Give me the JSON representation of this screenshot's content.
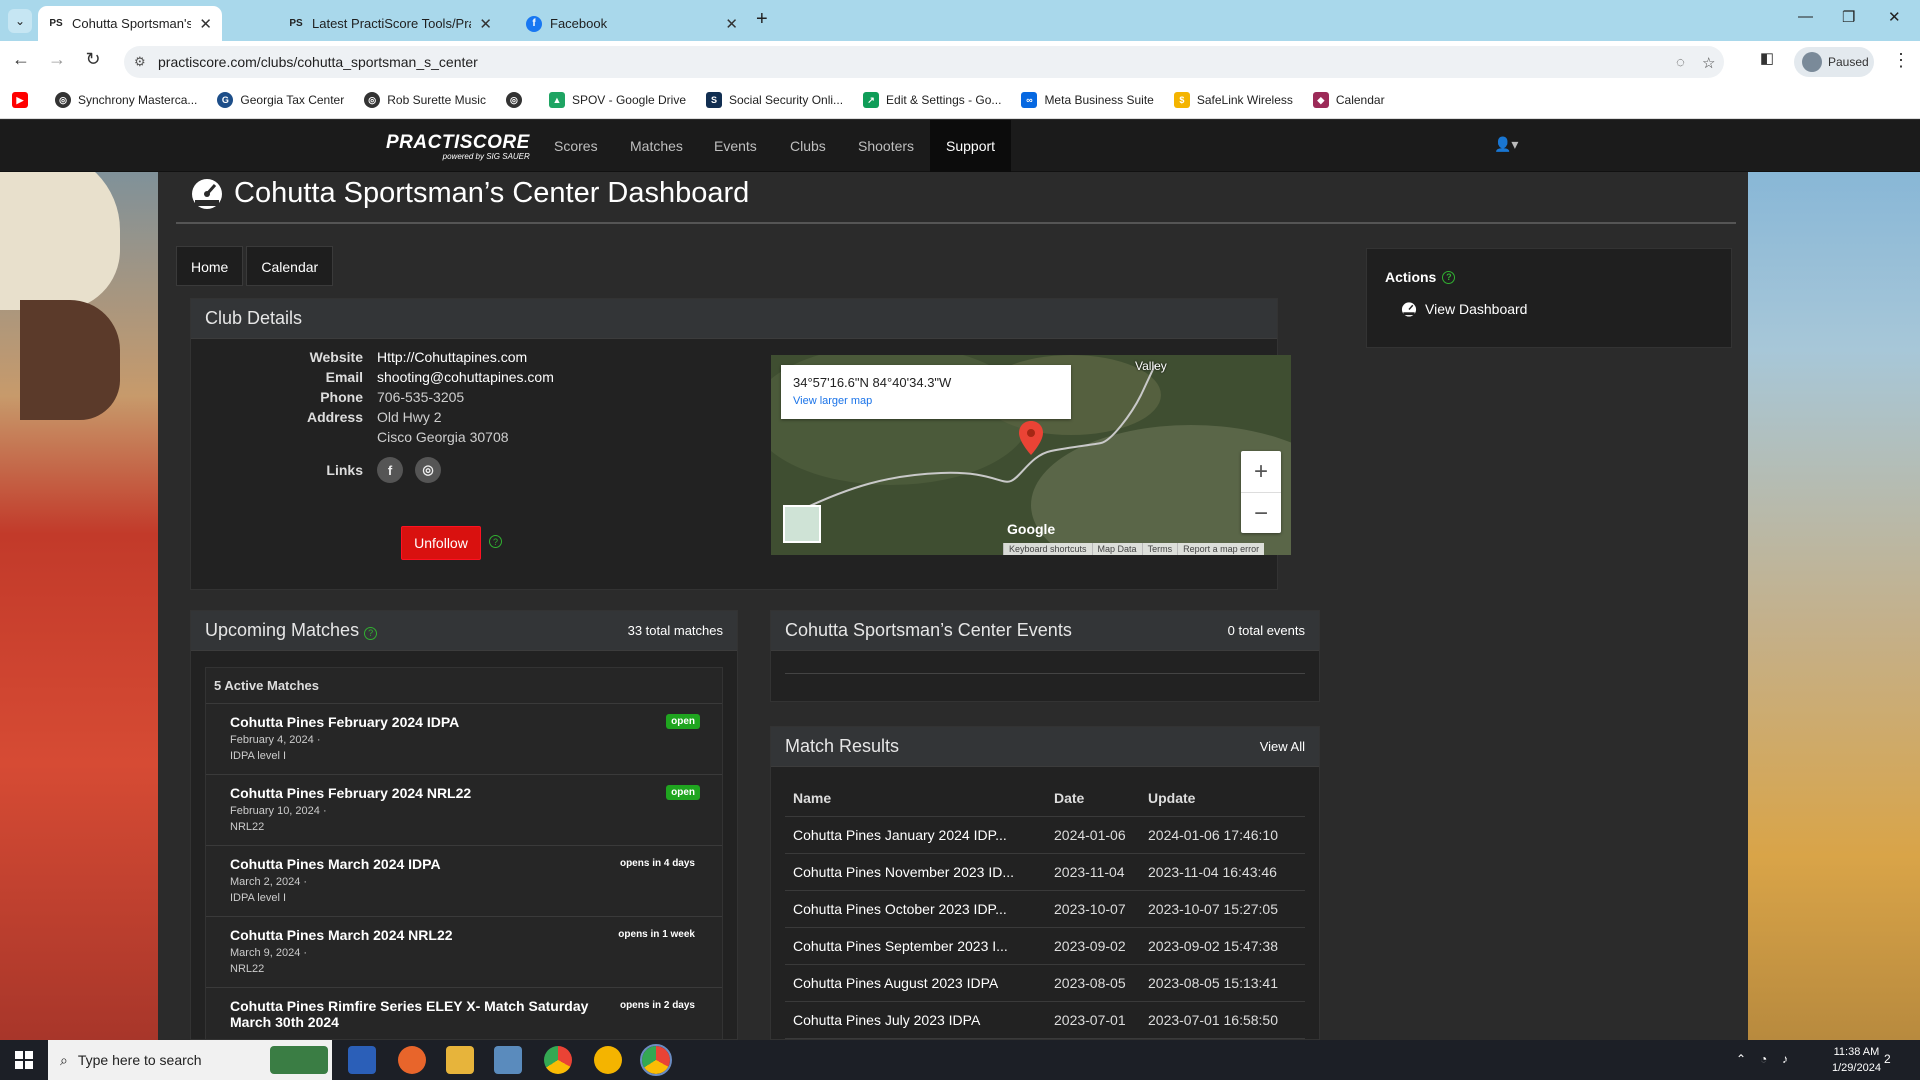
{
  "browser": {
    "tabs": [
      {
        "title": "Cohutta Sportsman's Center | P",
        "active": true,
        "icon": "practiscore-icon"
      },
      {
        "title": "Latest PractiScore Tools/PractiS",
        "active": false,
        "icon": "practiscore-icon"
      },
      {
        "title": "Facebook",
        "active": false,
        "icon": "facebook-icon"
      }
    ],
    "url": "practiscore.com/clubs/cohutta_sportsman_s_center",
    "profile_label": "Paused",
    "bookmarks": [
      {
        "label": "",
        "icon": "youtube-icon",
        "color": "#ff0000"
      },
      {
        "label": "Synchrony Masterca...",
        "icon": "globe-icon",
        "color": "#333333"
      },
      {
        "label": "Georgia Tax Center",
        "icon": "gtc-icon",
        "color": "#1d4e89"
      },
      {
        "label": "Rob Surette Music",
        "icon": "globe-icon",
        "color": "#333333"
      },
      {
        "label": "",
        "icon": "globe-icon",
        "color": "#333333"
      },
      {
        "label": "SPOV - Google Drive",
        "icon": "drive-icon",
        "color": "#1fa463"
      },
      {
        "label": "Social Security Onli...",
        "icon": "ssa-icon",
        "color": "#112e51"
      },
      {
        "label": "Edit & Settings - Go...",
        "icon": "analytics-icon",
        "color": "#0f9d58"
      },
      {
        "label": "Meta Business Suite",
        "icon": "meta-icon",
        "color": "#0668e1"
      },
      {
        "label": "SafeLink Wireless",
        "icon": "safelink-icon",
        "color": "#f4b400"
      },
      {
        "label": "Calendar",
        "icon": "calendar-icon",
        "color": "#9c2a58"
      }
    ]
  },
  "site": {
    "logo": "PRACTISCORE",
    "logo_sub": "powered by SIG SAUER",
    "nav": [
      "Scores",
      "Matches",
      "Events",
      "Clubs",
      "Shooters",
      "Support"
    ],
    "nav_active": "Support"
  },
  "page": {
    "title": "Cohutta Sportsman’s Center Dashboard",
    "subnav": [
      "Home",
      "Calendar"
    ]
  },
  "club_details": {
    "heading": "Club Details",
    "website_label": "Website",
    "website": "Http://Cohuttapines.com",
    "email_label": "Email",
    "email": "shooting@cohuttapines.com",
    "phone_label": "Phone",
    "phone": "706-535-3205",
    "address_label": "Address",
    "address_line1": "Old Hwy 2",
    "address_line2": "Cisco Georgia 30708",
    "links_label": "Links",
    "unfollow_label": "Unfollow"
  },
  "map": {
    "coords": "34°57'16.6\"N 84°40'34.3\"W",
    "larger_map": "View larger map",
    "place_label": "Valley",
    "brand": "Google",
    "footer": [
      "Keyboard shortcuts",
      "Map Data",
      "Terms",
      "Report a map error"
    ]
  },
  "upcoming": {
    "heading": "Upcoming Matches",
    "count": "33 total matches",
    "active_heading": "5 Active Matches",
    "matches": [
      {
        "name": "Cohutta Pines February 2024 IDPA",
        "date": "February 4, 2024 ·",
        "type": "IDPA level I",
        "badge": "open"
      },
      {
        "name": "Cohutta Pines February 2024 NRL22",
        "date": "February 10, 2024 ·",
        "type": "NRL22",
        "badge": "open"
      },
      {
        "name": "Cohutta Pines March 2024 IDPA",
        "date": "March 2, 2024 ·",
        "type": "IDPA level I",
        "badge": "opens in 4 days"
      },
      {
        "name": "Cohutta Pines March 2024 NRL22",
        "date": "March 9, 2024 ·",
        "type": "NRL22",
        "badge": "opens in 1 week"
      },
      {
        "name": "Cohutta Pines Rimfire Series ELEY X- Match Saturday",
        "date": "March 30th 2024",
        "type": "",
        "badge": "opens in 2 days"
      }
    ]
  },
  "events": {
    "heading": "Cohutta Sportsman’s Center Events",
    "count": "0 total events"
  },
  "results": {
    "heading": "Match Results",
    "view_all": "View All",
    "columns": [
      "Name",
      "Date",
      "Update"
    ],
    "rows": [
      [
        "Cohutta Pines January 2024 IDP...",
        "2024-01-06",
        "2024-01-06 17:46:10"
      ],
      [
        "Cohutta Pines November 2023 ID...",
        "2023-11-04",
        "2023-11-04 16:43:46"
      ],
      [
        "Cohutta Pines October 2023 IDP...",
        "2023-10-07",
        "2023-10-07 15:27:05"
      ],
      [
        "Cohutta Pines September 2023 I...",
        "2023-09-02",
        "2023-09-02 15:47:38"
      ],
      [
        "Cohutta Pines August 2023 IDPA",
        "2023-08-05",
        "2023-08-05 15:13:41"
      ],
      [
        "Cohutta Pines July 2023 IDPA",
        "2023-07-01",
        "2023-07-01 16:58:50"
      ]
    ]
  },
  "actions": {
    "heading": "Actions",
    "item": "View Dashboard"
  },
  "taskbar": {
    "search_placeholder": "Type here to search",
    "time": "11:38 AM",
    "date": "1/29/2024",
    "notifications": "2"
  },
  "colors": {
    "accent_red": "#d9110f",
    "open_green": "#1fa51f",
    "help_green": "#31b031"
  }
}
